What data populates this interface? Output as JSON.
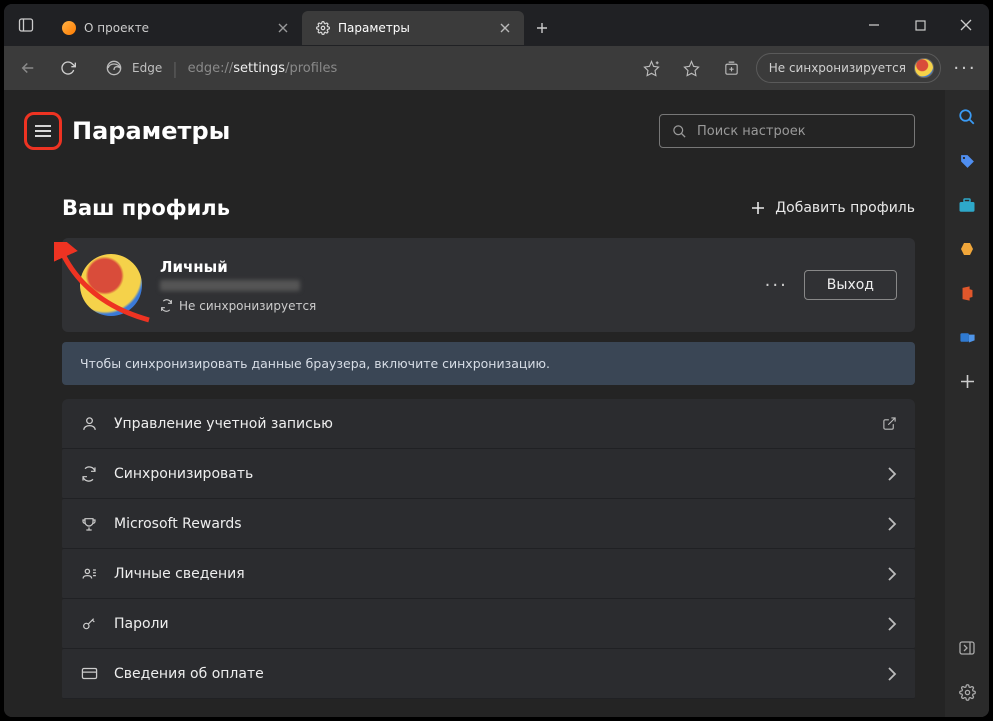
{
  "tabs": [
    {
      "label": "О проекте",
      "active": false
    },
    {
      "label": "Параметры",
      "active": true
    }
  ],
  "toolbar": {
    "browser_brand": "Edge",
    "url_prefix": "edge://",
    "url_main": "settings",
    "url_suffix": "/profiles",
    "sync_pill": "Не синхронизируется"
  },
  "settings": {
    "page_title": "Параметры",
    "search_placeholder": "Поиск настроек",
    "section_title": "Ваш профиль",
    "add_profile": "Добавить профиль",
    "profile": {
      "name": "Личный",
      "sync_status": "Не синхронизируется",
      "logout": "Выход"
    },
    "banner": "Чтобы синхронизировать данные браузера, включите синхронизацию.",
    "rows": [
      {
        "label": "Управление учетной записью",
        "external": true
      },
      {
        "label": "Синхронизировать",
        "external": false
      },
      {
        "label": "Microsoft Rewards",
        "external": false
      },
      {
        "label": "Личные сведения",
        "external": false
      },
      {
        "label": "Пароли",
        "external": false
      },
      {
        "label": "Сведения об оплате",
        "external": false
      }
    ]
  }
}
